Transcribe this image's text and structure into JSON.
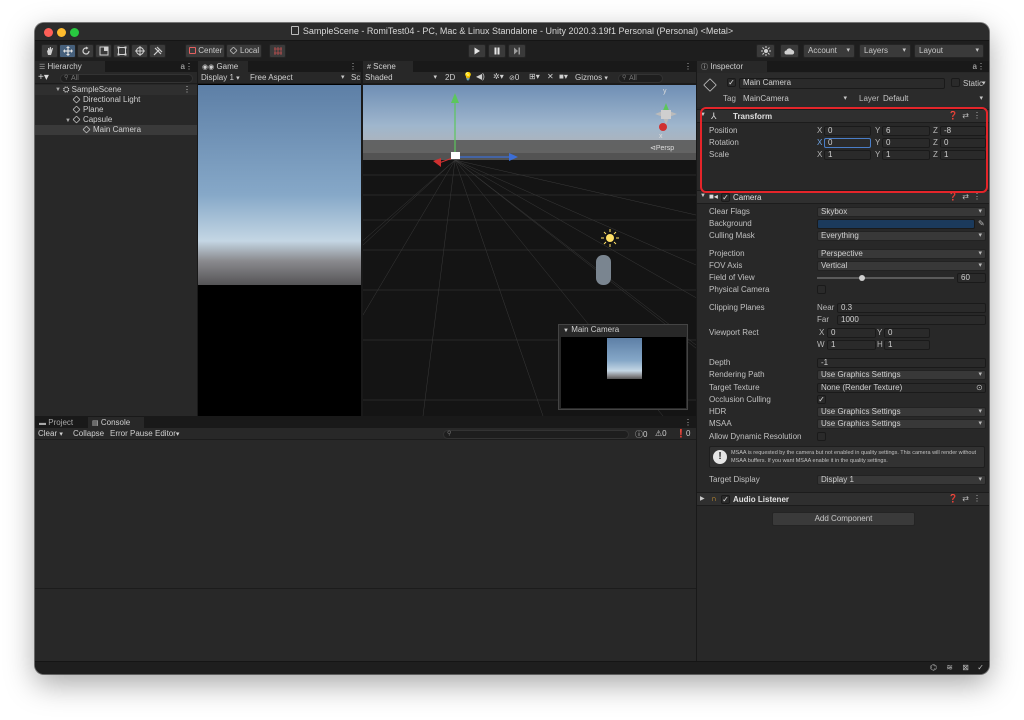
{
  "window": {
    "title": "SampleScene - RomiTest04 - PC, Mac & Linux Standalone - Unity 2020.3.19f1 Personal (Personal) <Metal>"
  },
  "toolbar": {
    "pivot_label": "Center",
    "space_label": "Local",
    "account_label": "Account",
    "layers_label": "Layers",
    "layout_label": "Layout"
  },
  "hierarchy": {
    "tab_label": "Hierarchy",
    "search_placeholder": "All",
    "items": [
      {
        "label": "SampleScene"
      },
      {
        "label": "Directional Light"
      },
      {
        "label": "Plane"
      },
      {
        "label": "Capsule"
      },
      {
        "label": "Main Camera"
      }
    ]
  },
  "game": {
    "tab_label": "Game",
    "display_label": "Display 1",
    "aspect_label": "Free Aspect",
    "scale_label": "Sc"
  },
  "scene": {
    "tab_label": "Scene",
    "shading_label": "Shaded",
    "mode_2d_label": "2D",
    "hidden_count": "0",
    "gizmos_label": "Gizmos",
    "search_placeholder": "All",
    "persp_label": "Persp",
    "gizmo_y": "y",
    "gizmo_x": "x",
    "camera_preview_title": "Main Camera"
  },
  "console": {
    "project_tab_label": "Project",
    "console_tab_label": "Console",
    "clear_label": "Clear",
    "collapse_label": "Collapse",
    "error_pause_label": "Error Pause",
    "editor_label": "Editor",
    "log_count": "0",
    "warn_count": "0",
    "error_count": "0"
  },
  "inspector": {
    "tab_label": "Inspector",
    "object_name": "Main Camera",
    "static_label": "Static",
    "tag_label": "Tag",
    "tag_value": "MainCamera",
    "layer_label": "Layer",
    "layer_value": "Default",
    "transform": {
      "title": "Transform",
      "position_label": "Position",
      "rotation_label": "Rotation",
      "scale_label": "Scale",
      "axis_x": "X",
      "axis_y": "Y",
      "axis_z": "Z",
      "position": {
        "x": "0",
        "y": "6",
        "z": "-8"
      },
      "rotation": {
        "x": "0",
        "y": "0",
        "z": "0"
      },
      "scale": {
        "x": "1",
        "y": "1",
        "z": "1"
      }
    },
    "camera": {
      "title": "Camera",
      "clear_flags_label": "Clear Flags",
      "clear_flags_value": "Skybox",
      "background_label": "Background",
      "background_color": "#1b3a5c",
      "culling_mask_label": "Culling Mask",
      "culling_mask_value": "Everything",
      "projection_label": "Projection",
      "projection_value": "Perspective",
      "fov_axis_label": "FOV Axis",
      "fov_axis_value": "Vertical",
      "fov_label": "Field of View",
      "fov_value": "60",
      "physical_camera_label": "Physical Camera",
      "clipping_planes_label": "Clipping Planes",
      "near_label": "Near",
      "near_value": "0.3",
      "far_label": "Far",
      "far_value": "1000",
      "viewport_rect_label": "Viewport Rect",
      "vp_x_label": "X",
      "vp_x": "0",
      "vp_y_label": "Y",
      "vp_y": "0",
      "vp_w_label": "W",
      "vp_w": "1",
      "vp_h_label": "H",
      "vp_h": "1",
      "depth_label": "Depth",
      "depth_value": "-1",
      "rendering_path_label": "Rendering Path",
      "rendering_path_value": "Use Graphics Settings",
      "target_texture_label": "Target Texture",
      "target_texture_value": "None (Render Texture)",
      "occlusion_culling_label": "Occlusion Culling",
      "hdr_label": "HDR",
      "hdr_value": "Use Graphics Settings",
      "msaa_label": "MSAA",
      "msaa_value": "Use Graphics Settings",
      "allow_dynamic_resolution_label": "Allow Dynamic Resolution",
      "msaa_warning": "MSAA is requested by the camera but not enabled in quality settings. This camera will render without MSAA buffers. If you want MSAA enable it in the quality settings.",
      "target_display_label": "Target Display",
      "target_display_value": "Display 1"
    },
    "audio_listener": {
      "title": "Audio Listener"
    },
    "add_component_label": "Add Component"
  },
  "colors": {
    "highlight": "#e5252a",
    "selection_accent": "#46607c"
  }
}
